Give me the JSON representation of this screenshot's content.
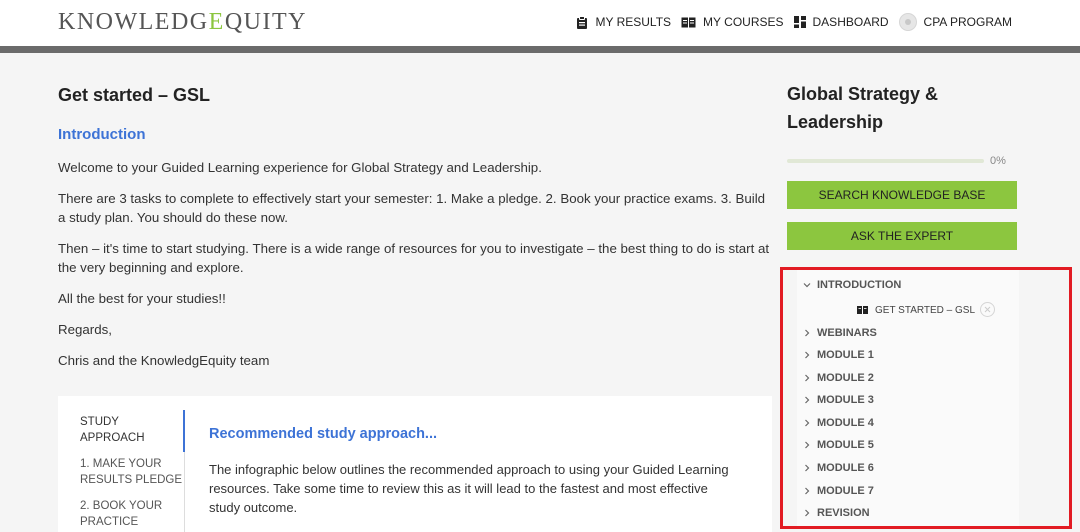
{
  "header": {
    "logo": {
      "part1": "KNOWLEDG",
      "part2": "E",
      "part3": "QUITY"
    },
    "nav": [
      {
        "label": "MY RESULTS",
        "icon": "clipboard-icon"
      },
      {
        "label": "MY COURSES",
        "icon": "book-icon"
      },
      {
        "label": "DASHBOARD",
        "icon": "dashboard-icon"
      },
      {
        "label": "CPA PROGRAM",
        "icon": "avatar"
      }
    ]
  },
  "main": {
    "title": "Get started – GSL",
    "intro_heading": "Introduction",
    "paragraphs": [
      "Welcome to your Guided Learning experience for Global Strategy and Leadership.",
      "There are 3 tasks to complete to effectively start your semester: 1. Make a pledge. 2. Book your practice exams. 3. Build a study plan. You should do these now.",
      "Then – it's time to start studying. There is a wide range of resources for you to investigate – the best thing to do is start at the very beginning and explore.",
      "All the best for your studies!!",
      "Regards,",
      "Chris and the KnowledgEquity team"
    ]
  },
  "card": {
    "side_items": [
      "STUDY APPROACH",
      "1. MAKE YOUR RESULTS PLEDGE",
      "2. BOOK YOUR PRACTICE"
    ],
    "heading": "Recommended study approach...",
    "text": "The infographic below outlines the recommended approach to using your Guided Learning resources. Take some time to review this as it will lead to the fastest and most effective study outcome."
  },
  "sidebar": {
    "course_title": "Global Strategy & Leadership",
    "progress_percent": 0,
    "progress_label": "0%",
    "buttons": [
      "SEARCH KNOWLEDGE BASE",
      "ASK THE EXPERT"
    ],
    "course_nav": [
      {
        "label": "INTRODUCTION",
        "expanded": true
      },
      {
        "label": "WEBINARS",
        "expanded": false
      },
      {
        "label": "MODULE 1",
        "expanded": false
      },
      {
        "label": "MODULE 2",
        "expanded": false
      },
      {
        "label": "MODULE 3",
        "expanded": false
      },
      {
        "label": "MODULE 4",
        "expanded": false
      },
      {
        "label": "MODULE 5",
        "expanded": false
      },
      {
        "label": "MODULE 6",
        "expanded": false
      },
      {
        "label": "MODULE 7",
        "expanded": false
      },
      {
        "label": "REVISION",
        "expanded": false
      }
    ],
    "intro_sub_item": "GET STARTED – GSL"
  },
  "colors": {
    "accent_green": "#8cc63f",
    "link_blue": "#3d73d6",
    "highlight_red": "#e21b23"
  }
}
